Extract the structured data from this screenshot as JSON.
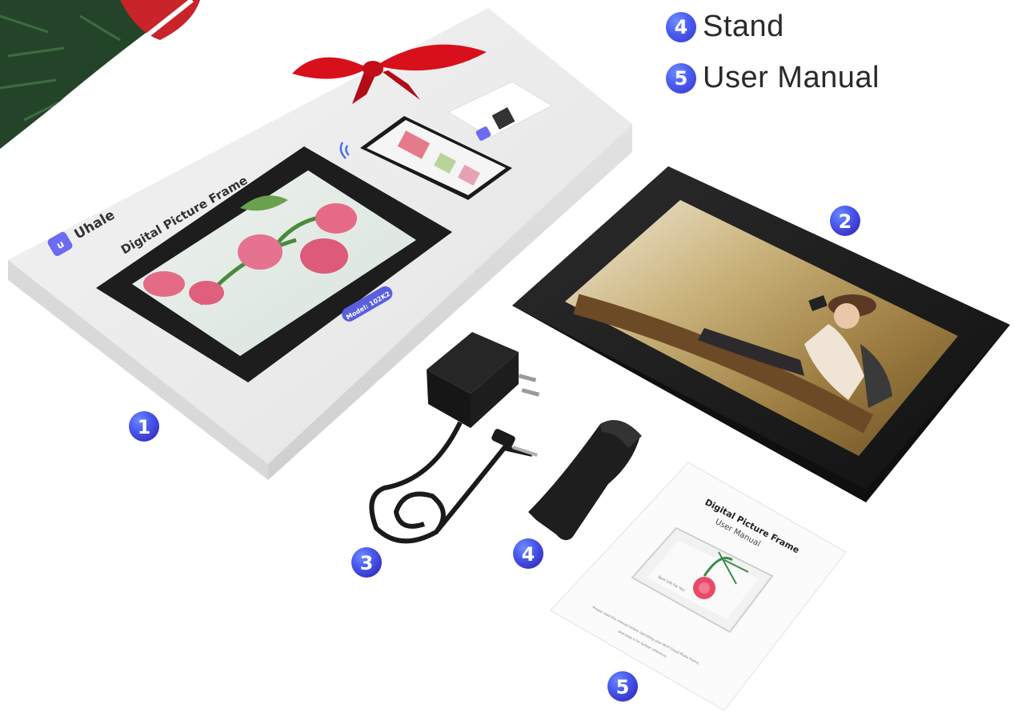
{
  "legend": [
    {
      "number": "4",
      "label": "Stand"
    },
    {
      "number": "5",
      "label": "User Manual"
    }
  ],
  "box": {
    "brand": "Uhale",
    "title": "Digital Picture Frame",
    "model": "Model: 102K2"
  },
  "manual": {
    "title": "Digital Picture Frame",
    "subtitle": "User Manual",
    "inner_text": "Best Gift For You",
    "footer_line1": "Please read this manual before operating your Wi-Fi Cloud Photo Frame,",
    "footer_line2": "and keep it for further reference."
  },
  "callouts": {
    "box": "1",
    "frame": "2",
    "adapter": "3",
    "stand": "4",
    "manual": "5"
  },
  "colors": {
    "badge": "#4a5cf0",
    "ribbon": "#d8101c",
    "frame": "#1c1c1c"
  }
}
